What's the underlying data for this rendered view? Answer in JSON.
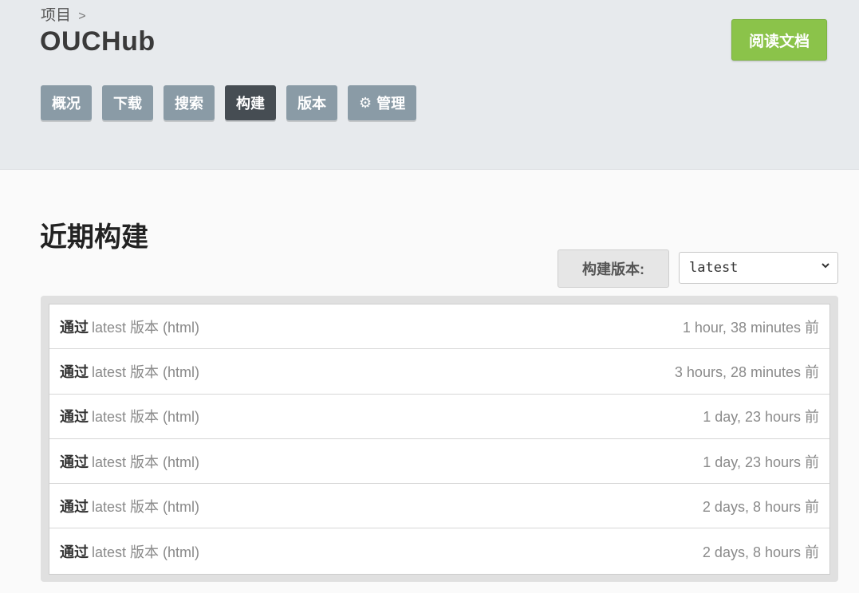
{
  "header": {
    "breadcrumb_label": "项目",
    "breadcrumb_sep": ">",
    "project_title": "OUCHub",
    "docs_button": "阅读文档"
  },
  "nav": {
    "items": [
      {
        "label": "概况"
      },
      {
        "label": "下载"
      },
      {
        "label": "搜索"
      },
      {
        "label": "构建"
      },
      {
        "label": "版本"
      },
      {
        "label": "管理",
        "icon": "gear-icon"
      }
    ],
    "active": "构建"
  },
  "builds": {
    "title": "近期构建",
    "version_label": "构建版本:",
    "version_selected": "latest",
    "rows": [
      {
        "status": "通过",
        "desc": "latest 版本 (html)",
        "time": "1 hour, 38 minutes 前"
      },
      {
        "status": "通过",
        "desc": "latest 版本 (html)",
        "time": "3 hours, 28 minutes 前"
      },
      {
        "status": "通过",
        "desc": "latest 版本 (html)",
        "time": "1 day, 23 hours 前"
      },
      {
        "status": "通过",
        "desc": "latest 版本 (html)",
        "time": "1 day, 23 hours 前"
      },
      {
        "status": "通过",
        "desc": "latest 版本 (html)",
        "time": "2 days, 8 hours 前"
      },
      {
        "status": "通过",
        "desc": "latest 版本 (html)",
        "time": "2 days, 8 hours 前"
      }
    ]
  },
  "colors": {
    "header_bg": "#e7eaed",
    "docs_button": "#8bc34a",
    "nav_button": "#8a9ba6",
    "nav_active": "#464d53"
  }
}
